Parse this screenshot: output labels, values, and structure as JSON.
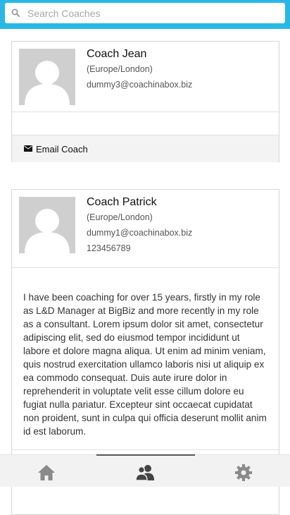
{
  "search": {
    "placeholder": "Search Coaches",
    "value": ""
  },
  "coaches": [
    {
      "name": "Coach Jean",
      "timezone": "(Europe/London)",
      "email": "dummy3@coachinabox.biz",
      "action_label": "Email Coach"
    },
    {
      "name": "Coach Patrick",
      "timezone": "(Europe/London)",
      "email": "dummy1@coachinabox.biz",
      "phone": "123456789",
      "bio": "I have been coaching for over 15 years, firstly in my role as L&D Manager at BigBiz and more recently in my role as a consultant. Lorem ipsum dolor sit amet, consectetur adipiscing elit, sed do eiusmod tempor incididunt ut labore et dolore magna aliqua. Ut enim ad minim veniam, quis nostrud exercitation ullamco laboris nisi ut aliquip ex ea commodo consequat. Duis aute irure dolor in reprehenderit in voluptate velit esse cillum dolore eu fugiat nulla pariatur. Excepteur sint occaecat cupidatat non proident, sunt in culpa qui officia deserunt mollit anim id est laborum."
    }
  ],
  "tabs": [
    {
      "icon": "home-icon",
      "active": false
    },
    {
      "icon": "users-icon",
      "active": true
    },
    {
      "icon": "gear-icon",
      "active": false
    }
  ],
  "colors": {
    "topbar": "#29b8e6",
    "avatar": "#cfcfcf",
    "tab_icon": "#8a8a8a",
    "tab_icon_active": "#444444"
  }
}
